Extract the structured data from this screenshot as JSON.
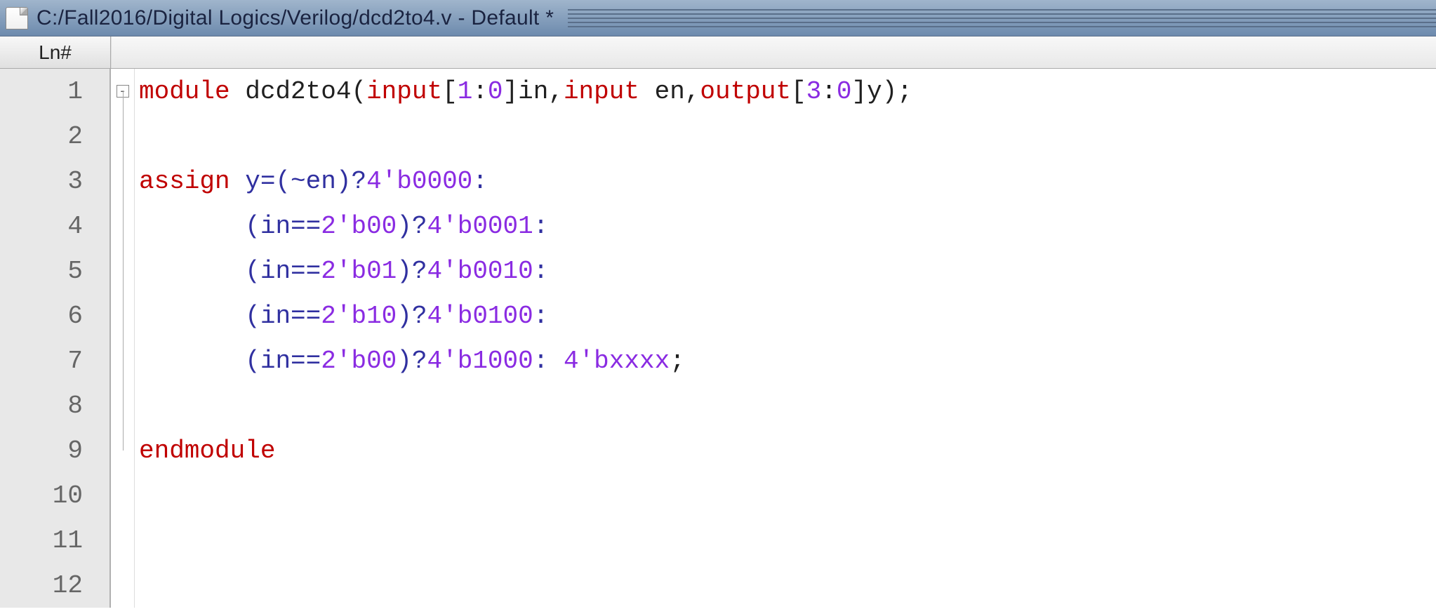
{
  "titlebar": {
    "path": "C:/Fall2016/Digital Logics/Verilog/dcd2to4.v - Default *"
  },
  "header": {
    "ln_label": "Ln#"
  },
  "fold": {
    "box_glyph": "-"
  },
  "lines": {
    "n1": "1",
    "n2": "2",
    "n3": "3",
    "n4": "4",
    "n5": "5",
    "n6": "6",
    "n7": "7",
    "n8": "8",
    "n9": "9",
    "n10": "10",
    "n11": "11",
    "n12": "12"
  },
  "code": {
    "l1a": "module",
    "l1b": " dcd2to4(",
    "l1c": "input",
    "l1d": "[",
    "l1e": "1",
    "l1f": ":",
    "l1g": "0",
    "l1h": "]in,",
    "l1i": "input",
    "l1j": " en,",
    "l1k": "output",
    "l1l": "[",
    "l1m": "3",
    "l1n": ":",
    "l1o": "0",
    "l1p": "]y);",
    "l3a": "assign",
    "l3b": " y=(~en)?",
    "l3c": "4'b0000",
    "l3d": ":",
    "ind": "       ",
    "l4a": "(in==",
    "l4b": "2'b00",
    "l4c": ")?",
    "l4d": "4'b0001",
    "l4e": ":",
    "l5a": "(in==",
    "l5b": "2'b01",
    "l5c": ")?",
    "l5d": "4'b0010",
    "l5e": ":",
    "l6a": "(in==",
    "l6b": "2'b10",
    "l6c": ")?",
    "l6d": "4'b0100",
    "l6e": ":",
    "l7a": "(in==",
    "l7b": "2'b00",
    "l7c": ")?",
    "l7d": "4'b1000",
    "l7e": ": ",
    "l7f": "4'bxxxx",
    "l7g": ";",
    "l9a": "endmodule"
  }
}
